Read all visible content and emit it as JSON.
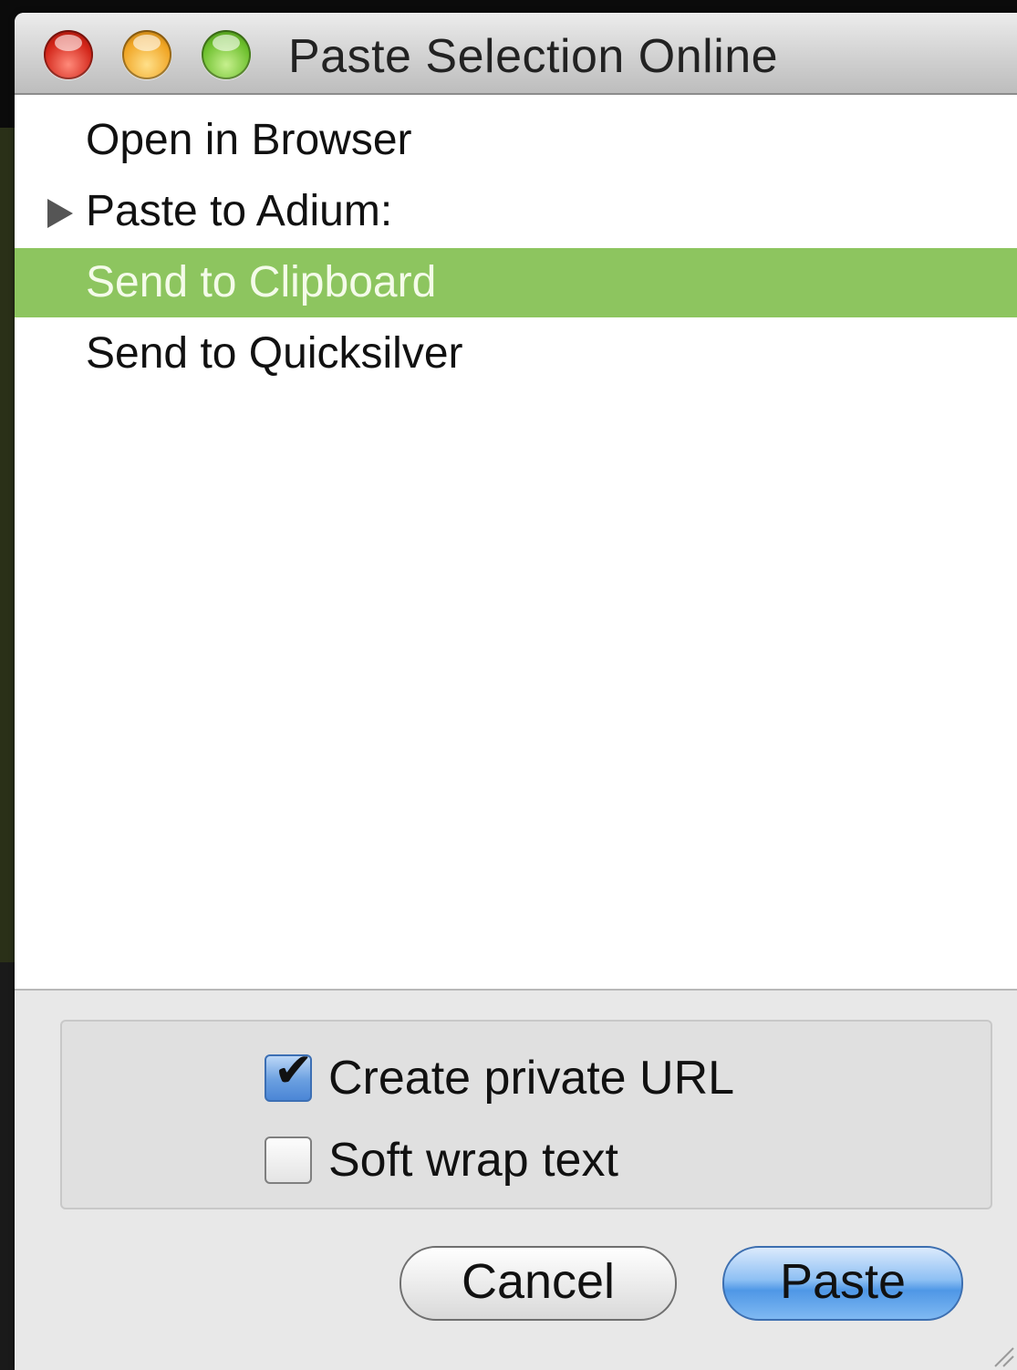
{
  "window": {
    "title": "Paste Selection Online"
  },
  "list": {
    "items": [
      {
        "label": "Open in Browser",
        "has_disclosure": false,
        "selected": false
      },
      {
        "label": "Paste to Adium:",
        "has_disclosure": true,
        "selected": false
      },
      {
        "label": "Send to Clipboard",
        "has_disclosure": false,
        "selected": true
      },
      {
        "label": "Send to Quicksilver",
        "has_disclosure": false,
        "selected": false
      }
    ],
    "selection_color": "#8dc55f"
  },
  "options": {
    "private_url": {
      "label": "Create private URL",
      "checked": true
    },
    "soft_wrap": {
      "label": "Soft wrap text",
      "checked": false
    }
  },
  "buttons": {
    "cancel_label": "Cancel",
    "paste_label": "Paste"
  }
}
